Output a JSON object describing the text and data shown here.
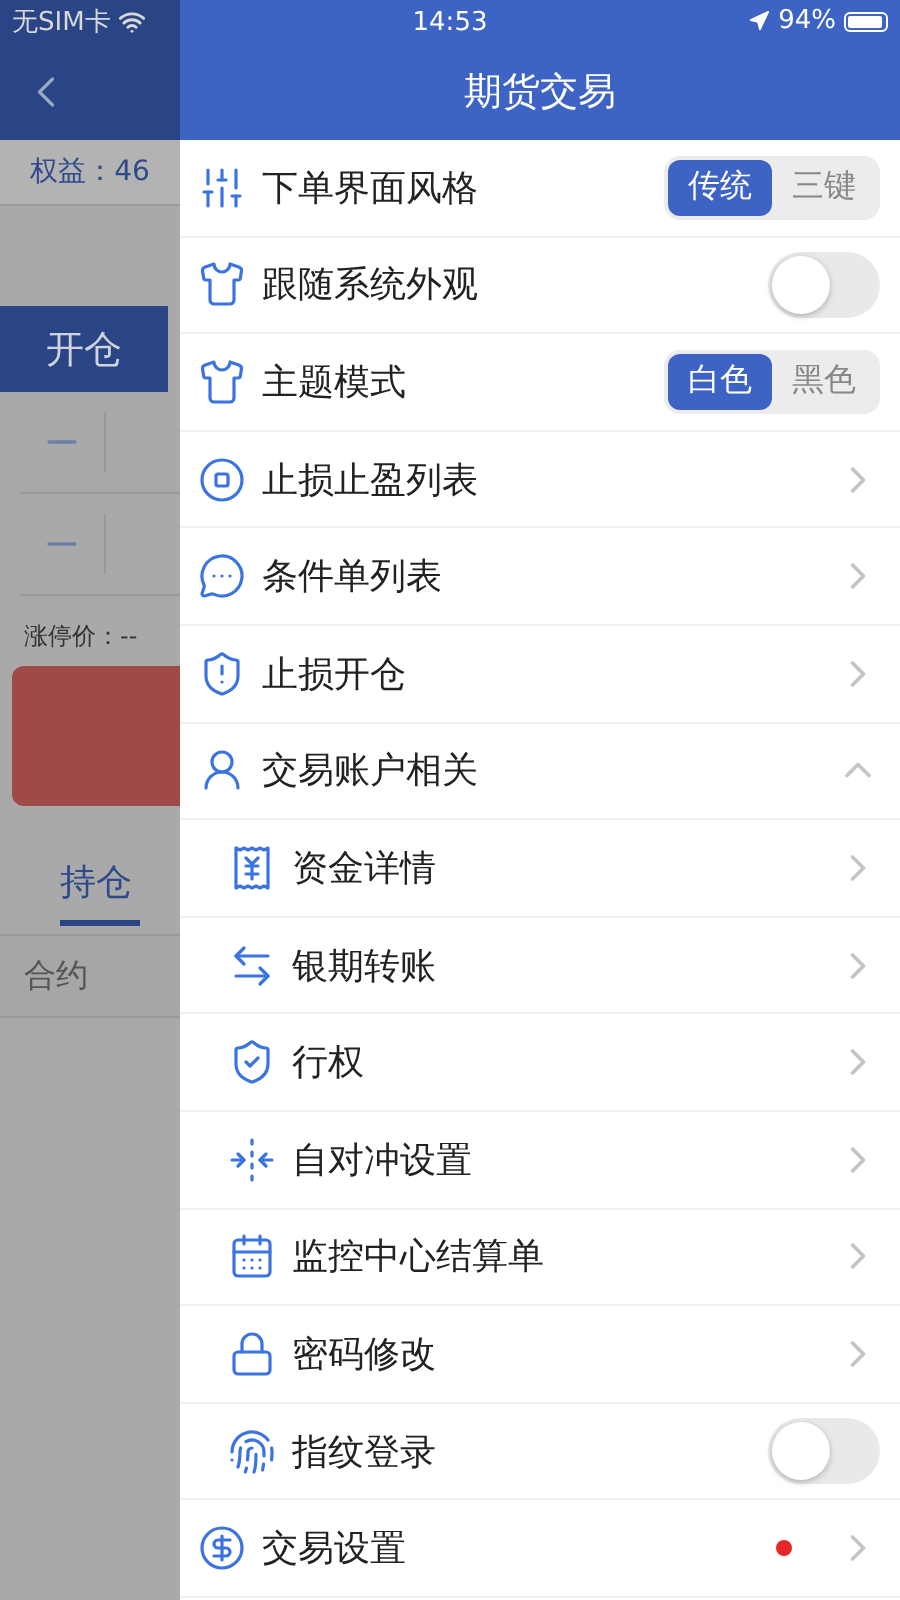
{
  "status_bar": {
    "carrier": "无SIM卡",
    "time": "14:53",
    "battery": "94%"
  },
  "back_page": {
    "equity": "权益：46",
    "open_tab": "开仓",
    "limit_up": "涨停价：--",
    "position_tab": "持仓",
    "contract_column": "合约"
  },
  "drawer": {
    "title": "期货交易",
    "items": [
      {
        "kind": "segment",
        "label": "下单界面风格",
        "options": [
          {
            "label": "传统",
            "selected": true
          },
          {
            "label": "三键",
            "selected": false
          }
        ]
      },
      {
        "kind": "toggle",
        "label": "跟随系统外观",
        "on": false
      },
      {
        "kind": "segment",
        "label": "主题模式",
        "options": [
          {
            "label": "白色",
            "selected": true
          },
          {
            "label": "黑色",
            "selected": false
          }
        ]
      },
      {
        "kind": "link",
        "label": "止损止盈列表"
      },
      {
        "kind": "link",
        "label": "条件单列表"
      },
      {
        "kind": "link",
        "label": "止损开仓"
      },
      {
        "kind": "group",
        "label": "交易账户相关",
        "expanded": true,
        "children": [
          {
            "kind": "link",
            "label": "资金详情"
          },
          {
            "kind": "link",
            "label": "银期转账"
          },
          {
            "kind": "link",
            "label": "行权"
          },
          {
            "kind": "link",
            "label": "自对冲设置"
          },
          {
            "kind": "link",
            "label": "监控中心结算单"
          },
          {
            "kind": "link",
            "label": "密码修改"
          },
          {
            "kind": "toggle",
            "label": "指纹登录",
            "on": false
          }
        ]
      },
      {
        "kind": "link",
        "label": "交易设置",
        "unread": true
      }
    ]
  }
}
